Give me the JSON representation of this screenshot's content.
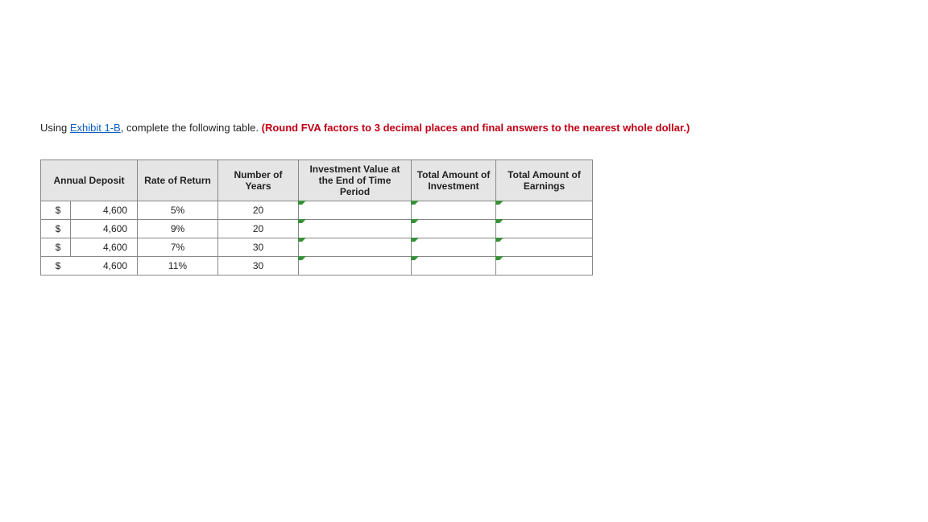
{
  "instruction": {
    "pre": "Using ",
    "link": "Exhibit 1-B",
    "mid": ", complete the following table. ",
    "bold": "(Round FVA factors to 3 decimal places and final answers to the nearest whole dollar.)"
  },
  "headers": {
    "deposit": "Annual Deposit",
    "rate": "Rate of Return",
    "years": "Number of Years",
    "ivet": "Investment Value at the End of Time Period",
    "totinv": "Total Amount of Investment",
    "totearn": "Total Amount of Earnings"
  },
  "rows": [
    {
      "sign": "$",
      "deposit": "4,600",
      "rate": "5%",
      "years": "20"
    },
    {
      "sign": "$",
      "deposit": "4,600",
      "rate": "9%",
      "years": "20"
    },
    {
      "sign": "$",
      "deposit": "4,600",
      "rate": "7%",
      "years": "30"
    },
    {
      "sign": "$",
      "deposit": "4,600",
      "rate": "11%",
      "years": "30"
    }
  ]
}
